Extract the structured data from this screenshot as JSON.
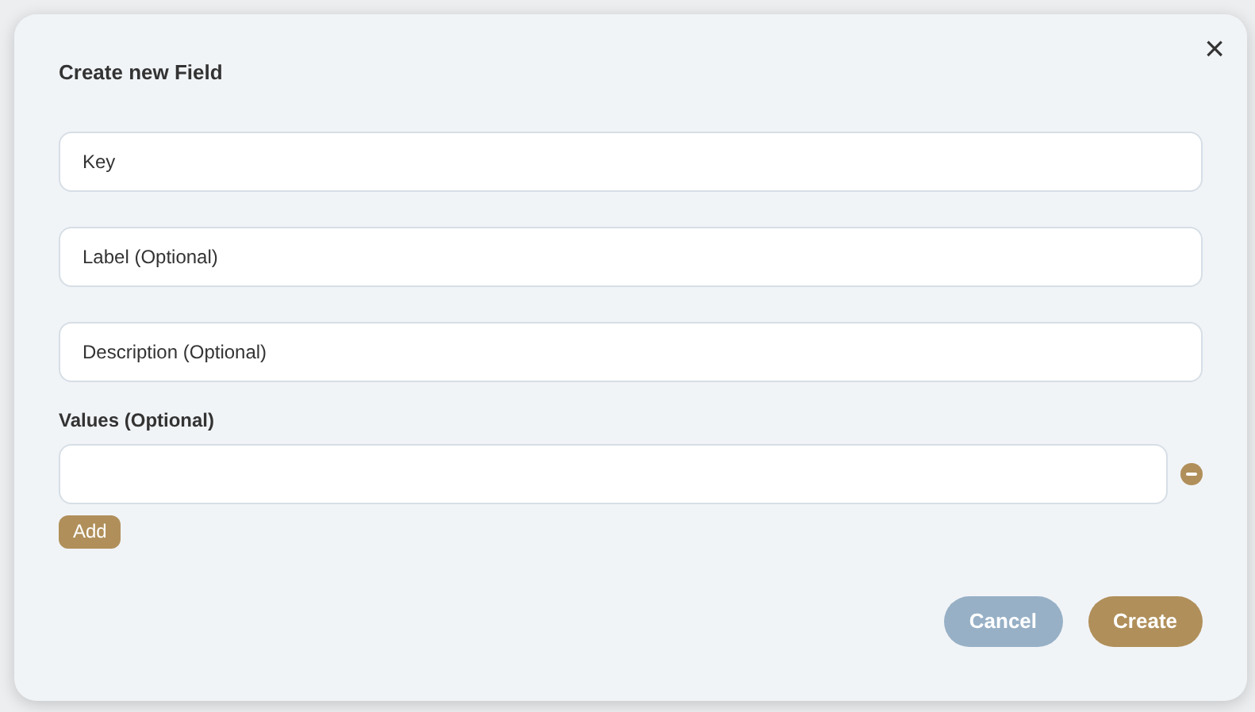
{
  "dialog": {
    "title": "Create new Field",
    "close": "×"
  },
  "fields": [
    {
      "placeholder": "Key"
    },
    {
      "placeholder": "Label (Optional)"
    },
    {
      "placeholder": "Description (Optional)"
    }
  ],
  "values": {
    "label": "Values (Optional)",
    "rows": [
      {
        "value": ""
      }
    ],
    "add_button": "Add"
  },
  "buttons": [
    {
      "label": "Cancel",
      "kind": "secondary"
    },
    {
      "label": "Create",
      "kind": "primary"
    }
  ]
}
